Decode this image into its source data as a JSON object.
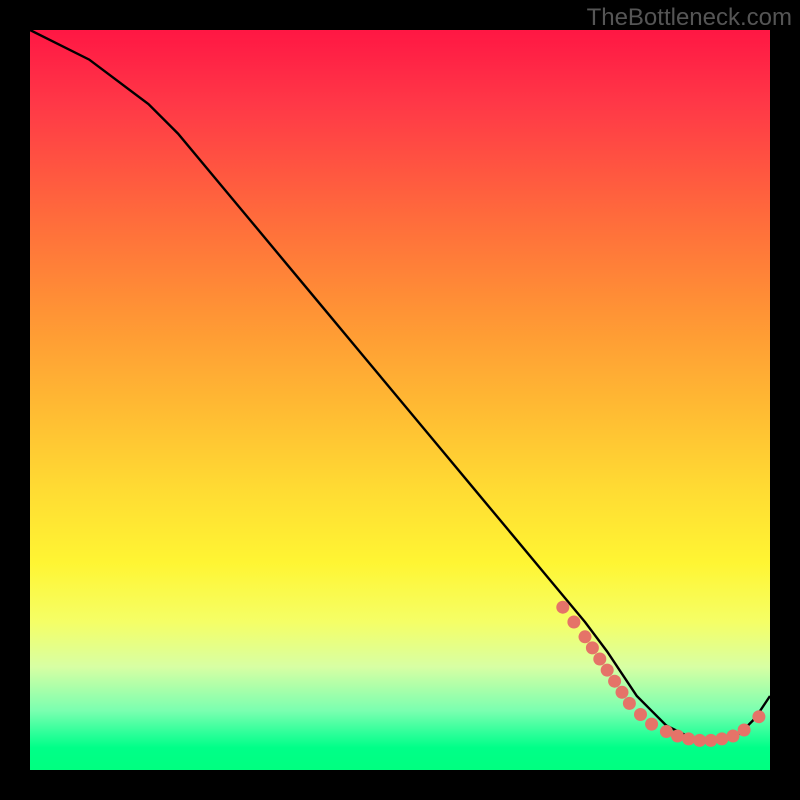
{
  "watermark": "TheBottleneck.com",
  "chart_data": {
    "type": "line",
    "title": "",
    "xlabel": "",
    "ylabel": "",
    "xlim": [
      0,
      100
    ],
    "ylim": [
      0,
      100
    ],
    "series": [
      {
        "name": "curve",
        "x": [
          0,
          4,
          8,
          12,
          16,
          20,
          25,
          30,
          35,
          40,
          45,
          50,
          55,
          60,
          65,
          70,
          75,
          78,
          80,
          82,
          84,
          86,
          88,
          90,
          92,
          94,
          96,
          98,
          100
        ],
        "y": [
          100,
          98,
          96,
          93,
          90,
          86,
          80,
          74,
          68,
          62,
          56,
          50,
          44,
          38,
          32,
          26,
          20,
          16,
          13,
          10,
          8,
          6,
          5,
          4,
          4,
          4,
          5,
          7,
          10
        ]
      }
    ],
    "markers": [
      {
        "x": 72,
        "y": 22
      },
      {
        "x": 73.5,
        "y": 20
      },
      {
        "x": 75,
        "y": 18
      },
      {
        "x": 76,
        "y": 16.5
      },
      {
        "x": 77,
        "y": 15
      },
      {
        "x": 78,
        "y": 13.5
      },
      {
        "x": 79,
        "y": 12
      },
      {
        "x": 80,
        "y": 10.5
      },
      {
        "x": 81,
        "y": 9
      },
      {
        "x": 82.5,
        "y": 7.5
      },
      {
        "x": 84,
        "y": 6.2
      },
      {
        "x": 86,
        "y": 5.2
      },
      {
        "x": 87.5,
        "y": 4.6
      },
      {
        "x": 89,
        "y": 4.2
      },
      {
        "x": 90.5,
        "y": 4.0
      },
      {
        "x": 92,
        "y": 4.0
      },
      {
        "x": 93.5,
        "y": 4.2
      },
      {
        "x": 95,
        "y": 4.6
      },
      {
        "x": 96.5,
        "y": 5.4
      },
      {
        "x": 98.5,
        "y": 7.2
      }
    ],
    "marker_color": "#e57368",
    "line_color": "#000000"
  }
}
